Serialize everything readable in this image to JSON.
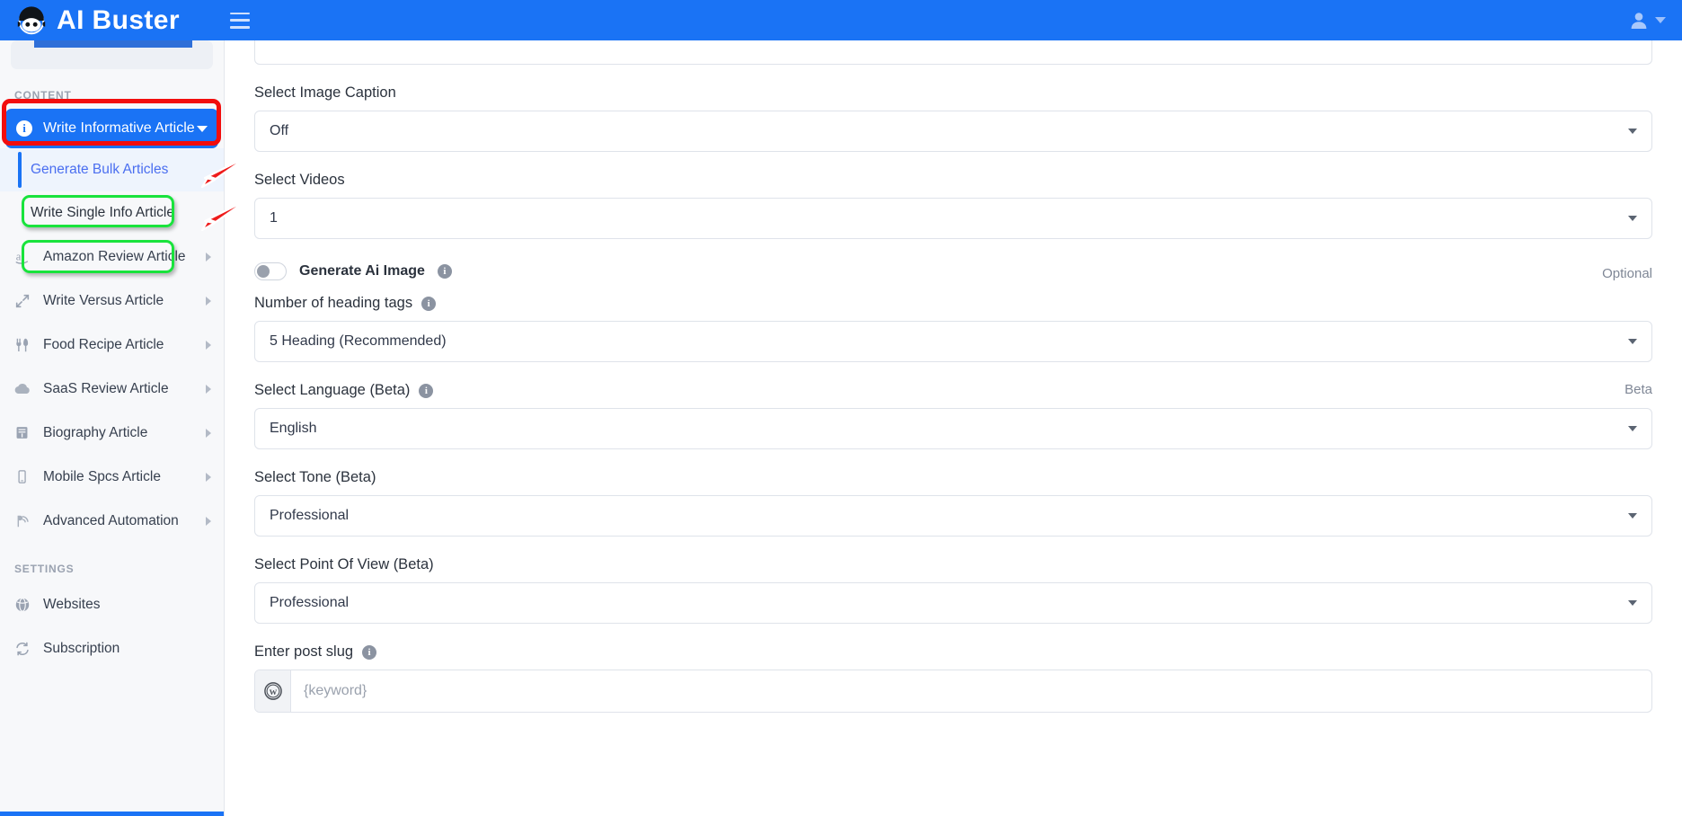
{
  "topbar": {
    "brand_name": "AI Buster",
    "logo_icon": "robot-face-icon",
    "menu_icon": "hamburger-menu-icon",
    "user_icon": "user-avatar-icon",
    "user_caret_icon": "chevron-down-icon"
  },
  "sidebar": {
    "sections": [
      {
        "label": "CONTENT"
      },
      {
        "label": "SETTINGS"
      }
    ],
    "active_item": {
      "label": "Write Informative Article",
      "icon": "info-circle-icon",
      "expand_icon": "chevron-down-icon",
      "annotation": "red-rectangle-highlight"
    },
    "sub_items": [
      {
        "label": "Generate Bulk Articles",
        "annotation": "green-rounded-highlight",
        "pointer": "red-arrow"
      },
      {
        "label": "Write Single Info Article",
        "annotation": "green-rounded-highlight",
        "pointer": "red-arrow"
      }
    ],
    "content_items": [
      {
        "label": "Amazon Review Article",
        "icon": "amazon-a-icon",
        "chevron": "chevron-right-icon"
      },
      {
        "label": "Write Versus Article",
        "icon": "versus-arrows-icon",
        "chevron": "chevron-right-icon"
      },
      {
        "label": "Food Recipe Article",
        "icon": "fork-knife-icon",
        "chevron": "chevron-right-icon"
      },
      {
        "label": "SaaS Review Article",
        "icon": "cloud-icon",
        "chevron": "chevron-right-icon"
      },
      {
        "label": "Biography Article",
        "icon": "book-icon",
        "chevron": "chevron-right-icon"
      },
      {
        "label": "Mobile Spcs Article",
        "icon": "mobile-phone-icon",
        "chevron": "chevron-right-icon"
      },
      {
        "label": "Advanced Automation",
        "icon": "broadcast-icon",
        "chevron": "chevron-right-icon"
      }
    ],
    "settings_items": [
      {
        "label": "Websites",
        "icon": "globe-icon"
      },
      {
        "label": "Subscription",
        "icon": "refresh-sync-icon"
      }
    ]
  },
  "form": {
    "fields": [
      {
        "label": "Select Image Caption",
        "value": "Off",
        "caret_icon": "chevron-down-icon"
      },
      {
        "label": "Select Videos",
        "value": "1",
        "caret_icon": "chevron-down-icon"
      }
    ],
    "generate_ai_image": {
      "label": "Generate Ai Image",
      "info_icon": "info-circle-icon",
      "toggle_state": "off",
      "side_note": "Optional"
    },
    "heading_tags": {
      "label": "Number of heading tags",
      "info_icon": "info-circle-icon",
      "value": "5 Heading (Recommended)",
      "caret_icon": "chevron-down-icon"
    },
    "language": {
      "label": "Select Language (Beta)",
      "info_icon": "info-circle-icon",
      "value": "English",
      "caret_icon": "chevron-down-icon",
      "side_note": "Beta"
    },
    "tone": {
      "label": "Select Tone (Beta)",
      "value": "Professional",
      "caret_icon": "chevron-down-icon"
    },
    "point_of_view": {
      "label": "Select Point Of View (Beta)",
      "value": "Professional",
      "caret_icon": "chevron-down-icon"
    },
    "post_slug": {
      "label": "Enter post slug",
      "info_icon": "info-circle-icon",
      "prefix_icon": "wordpress-icon",
      "placeholder": "{keyword}",
      "value": ""
    }
  },
  "colors": {
    "brand_blue": "#1a73f5",
    "annotation_red": "#f20d0d",
    "annotation_green": "#19e33c",
    "sidebar_bg": "#f7f8fa"
  }
}
